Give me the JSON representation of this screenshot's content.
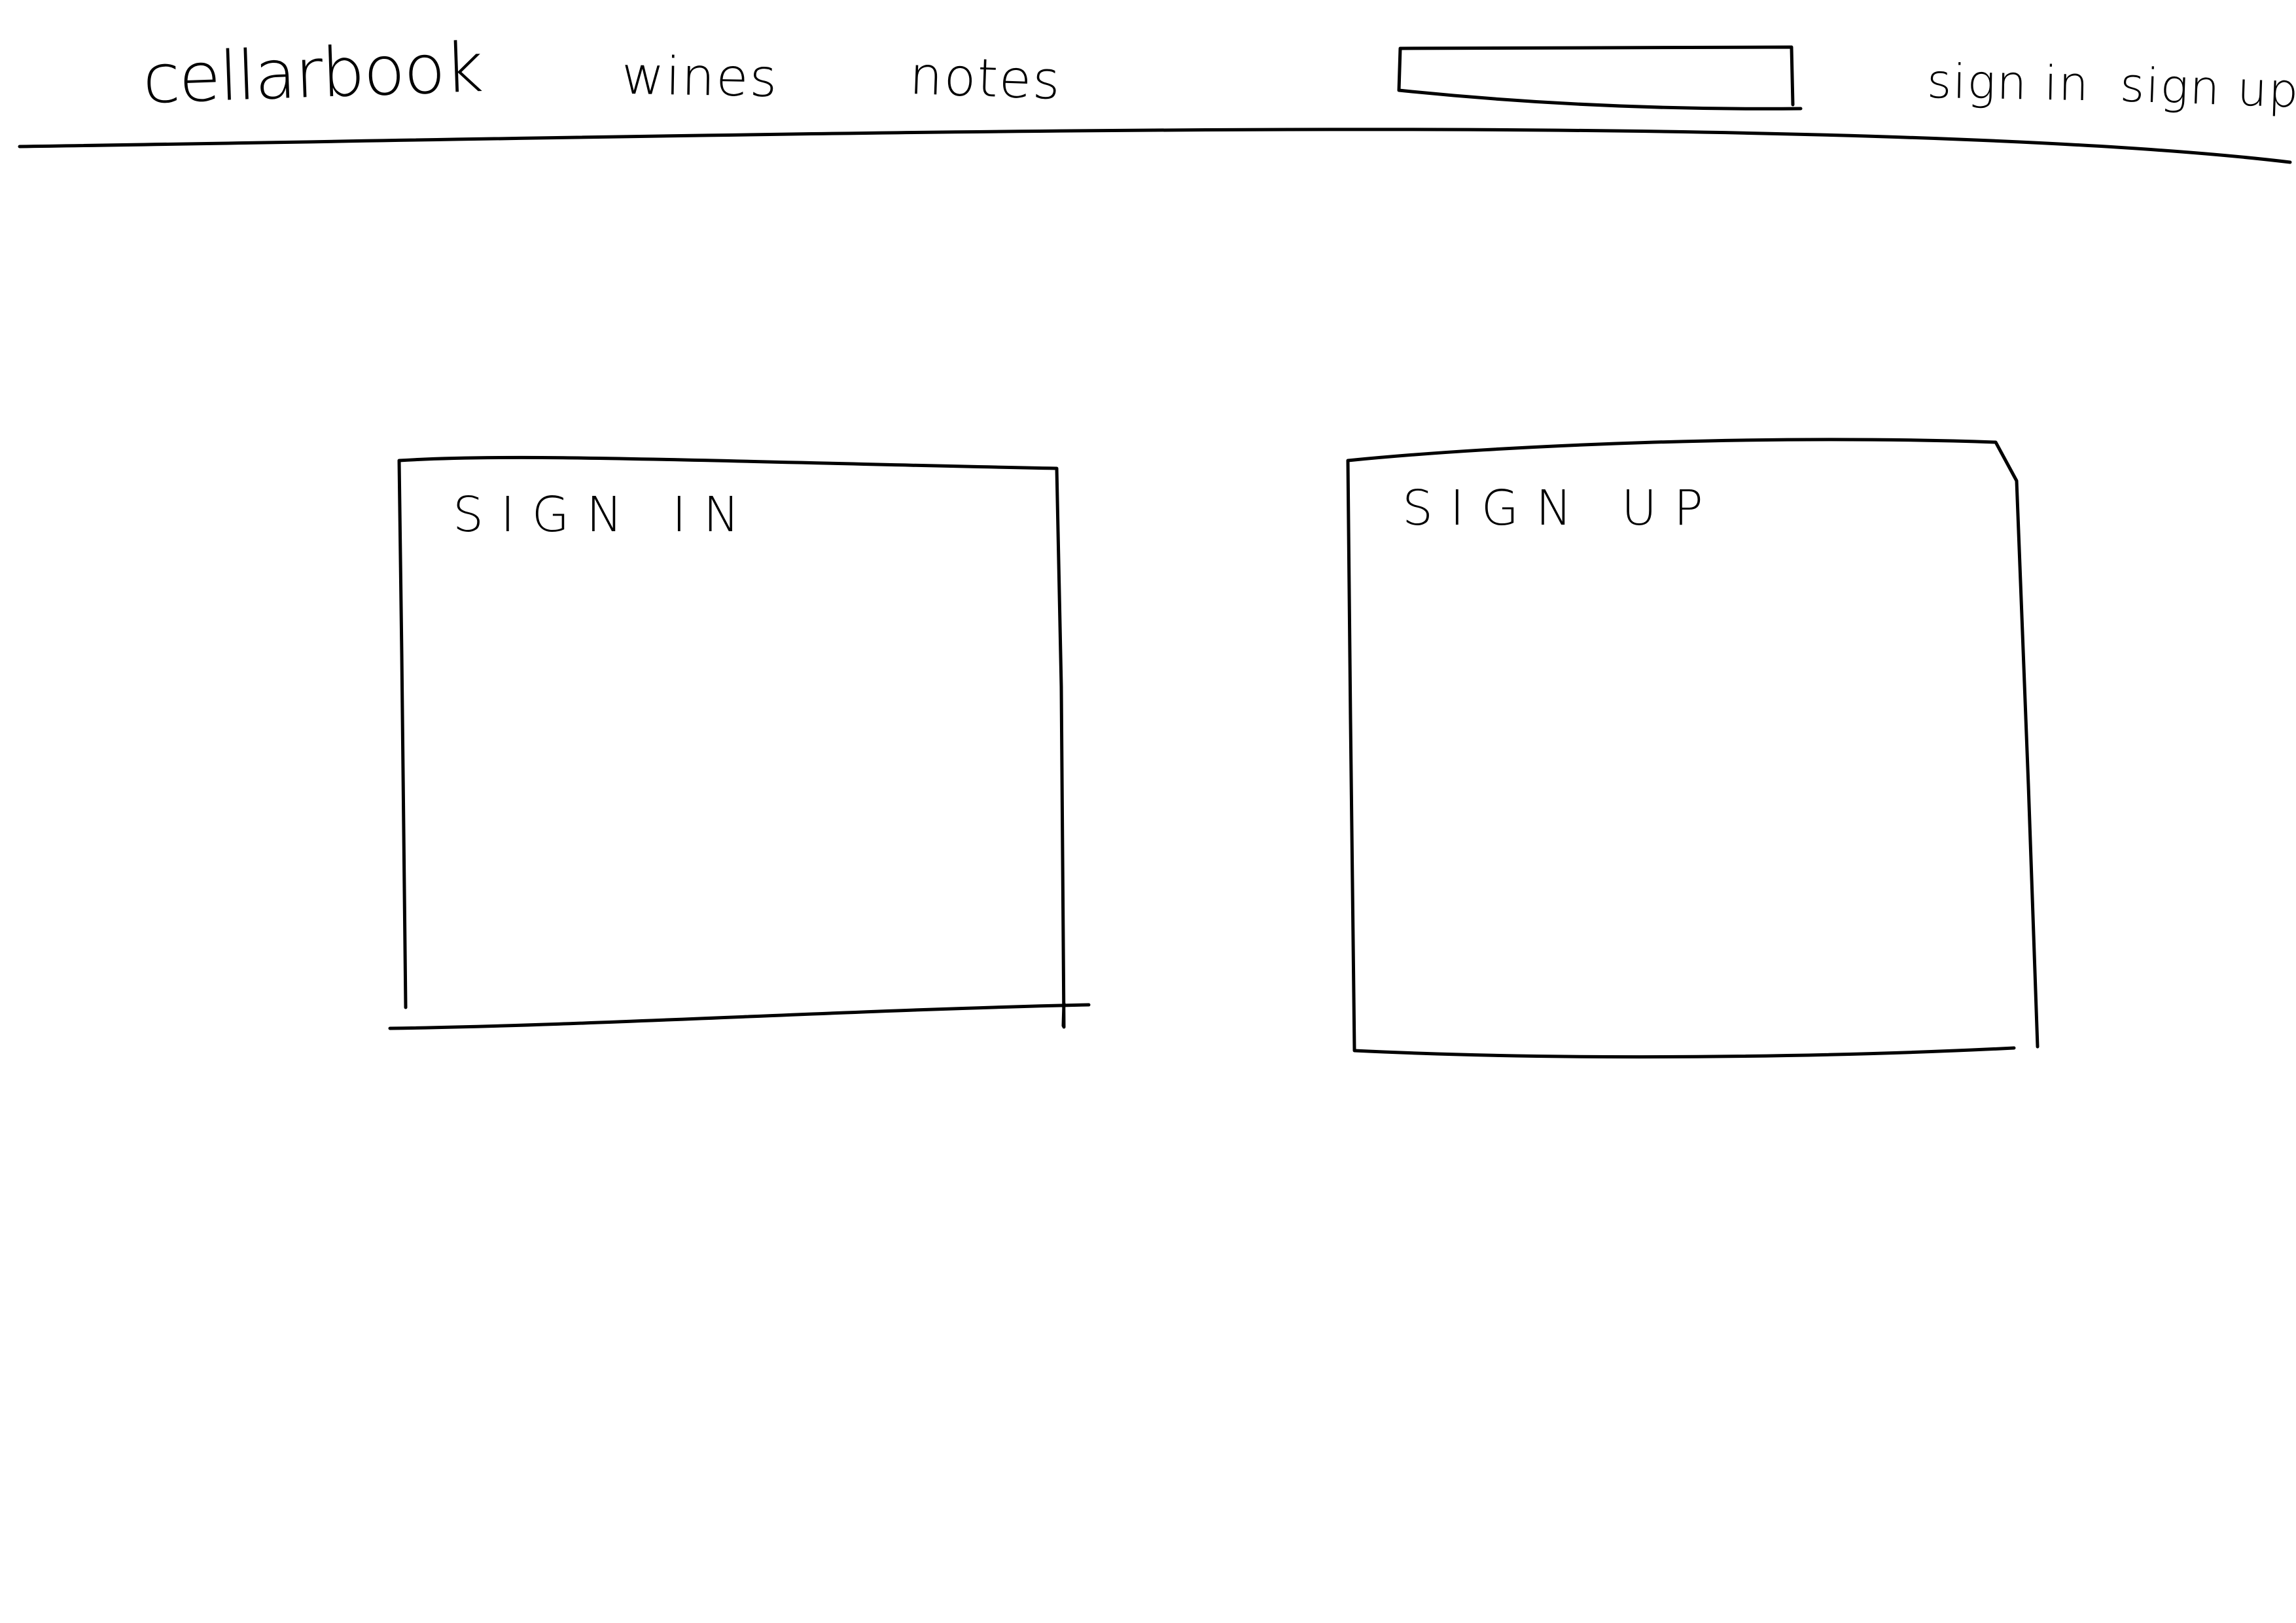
{
  "header": {
    "brand": "cellarbook",
    "nav": [
      {
        "label": "wines"
      },
      {
        "label": "notes"
      }
    ],
    "search": {
      "placeholder": ""
    },
    "auth_links": [
      {
        "label": "sign in"
      },
      {
        "label": "sign up"
      }
    ]
  },
  "main": {
    "signin_panel": {
      "title": "SIGN IN"
    },
    "signup_panel": {
      "title": "SIGN UP"
    }
  },
  "colors": {
    "ink": "#000000",
    "paper": "#ffffff"
  }
}
